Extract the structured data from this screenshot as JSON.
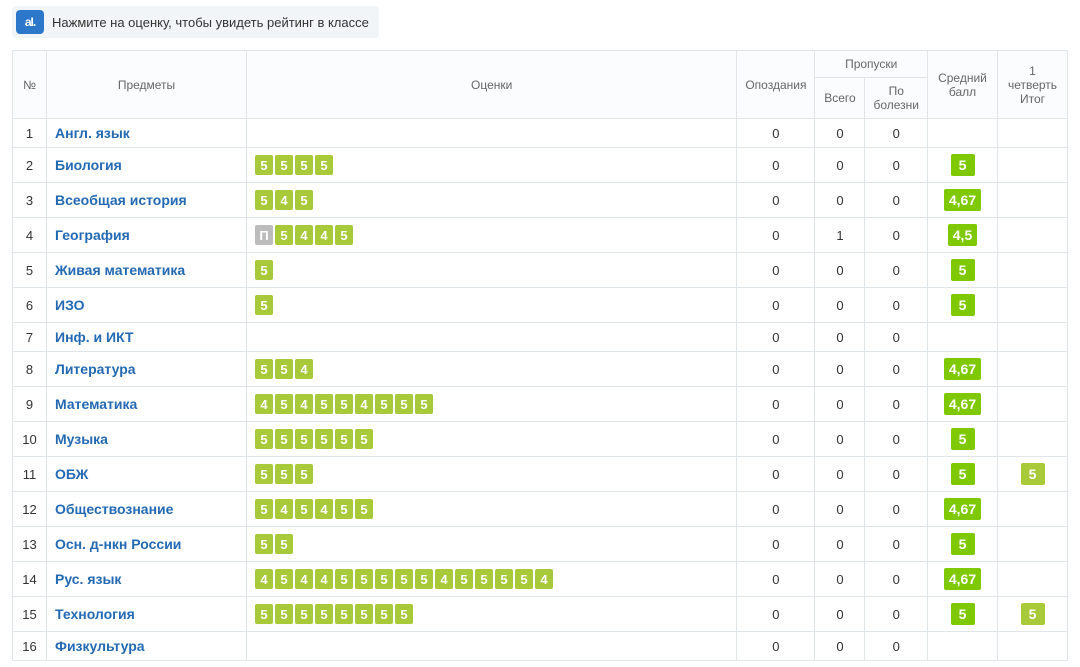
{
  "tip": {
    "icon_label": "aI.",
    "text": "Нажмите на оценку, чтобы увидеть рейтинг в классе"
  },
  "headers": {
    "num": "№",
    "subject": "Предметы",
    "marks": "Оценки",
    "late": "Опоздания",
    "miss_group": "Пропуски",
    "miss_total": "Всего",
    "miss_ill": "По болезни",
    "avg": "Средний балл",
    "term": "1 четверть Итог"
  },
  "rows": [
    {
      "n": "1",
      "subject": "Англ. язык",
      "marks": [],
      "late": "0",
      "miss_total": "0",
      "miss_ill": "0",
      "avg": "",
      "term": ""
    },
    {
      "n": "2",
      "subject": "Биология",
      "marks": [
        "5",
        "5",
        "5",
        "5"
      ],
      "late": "0",
      "miss_total": "0",
      "miss_ill": "0",
      "avg": "5",
      "term": ""
    },
    {
      "n": "3",
      "subject": "Всеобщая история",
      "marks": [
        "5",
        "4",
        "5"
      ],
      "late": "0",
      "miss_total": "0",
      "miss_ill": "0",
      "avg": "4,67",
      "term": ""
    },
    {
      "n": "4",
      "subject": "География",
      "marks": [
        {
          "v": "П",
          "special": true
        },
        "5",
        "4",
        "4",
        "5"
      ],
      "late": "0",
      "miss_total": "1",
      "miss_ill": "0",
      "avg": "4,5",
      "term": ""
    },
    {
      "n": "5",
      "subject": "Живая математика",
      "marks": [
        "5"
      ],
      "late": "0",
      "miss_total": "0",
      "miss_ill": "0",
      "avg": "5",
      "term": ""
    },
    {
      "n": "6",
      "subject": "ИЗО",
      "marks": [
        "5"
      ],
      "late": "0",
      "miss_total": "0",
      "miss_ill": "0",
      "avg": "5",
      "term": ""
    },
    {
      "n": "7",
      "subject": "Инф. и ИКТ",
      "marks": [],
      "late": "0",
      "miss_total": "0",
      "miss_ill": "0",
      "avg": "",
      "term": ""
    },
    {
      "n": "8",
      "subject": "Литература",
      "marks": [
        "5",
        "5",
        "4"
      ],
      "late": "0",
      "miss_total": "0",
      "miss_ill": "0",
      "avg": "4,67",
      "term": ""
    },
    {
      "n": "9",
      "subject": "Математика",
      "marks": [
        "4",
        "5",
        "4",
        "5",
        "5",
        "4",
        "5",
        "5",
        "5"
      ],
      "late": "0",
      "miss_total": "0",
      "miss_ill": "0",
      "avg": "4,67",
      "term": ""
    },
    {
      "n": "10",
      "subject": "Музыка",
      "marks": [
        "5",
        "5",
        "5",
        "5",
        "5",
        "5"
      ],
      "late": "0",
      "miss_total": "0",
      "miss_ill": "0",
      "avg": "5",
      "term": ""
    },
    {
      "n": "11",
      "subject": "ОБЖ",
      "marks": [
        "5",
        "5",
        "5"
      ],
      "late": "0",
      "miss_total": "0",
      "miss_ill": "0",
      "avg": "5",
      "term": "5"
    },
    {
      "n": "12",
      "subject": "Обществознание",
      "marks": [
        "5",
        "4",
        "5",
        "4",
        "5",
        "5"
      ],
      "late": "0",
      "miss_total": "0",
      "miss_ill": "0",
      "avg": "4,67",
      "term": ""
    },
    {
      "n": "13",
      "subject": "Осн. д-нкн России",
      "marks": [
        "5",
        "5"
      ],
      "late": "0",
      "miss_total": "0",
      "miss_ill": "0",
      "avg": "5",
      "term": ""
    },
    {
      "n": "14",
      "subject": "Рус. язык",
      "marks": [
        "4",
        "5",
        "4",
        "4",
        "5",
        "5",
        "5",
        "5",
        "5",
        "4",
        "5",
        "5",
        "5",
        "5",
        "4"
      ],
      "late": "0",
      "miss_total": "0",
      "miss_ill": "0",
      "avg": "4,67",
      "term": ""
    },
    {
      "n": "15",
      "subject": "Технология",
      "marks": [
        "5",
        "5",
        "5",
        "5",
        "5",
        "5",
        "5",
        "5"
      ],
      "late": "0",
      "miss_total": "0",
      "miss_ill": "0",
      "avg": "5",
      "term": "5"
    },
    {
      "n": "16",
      "subject": "Физкультура",
      "marks": [],
      "late": "0",
      "miss_total": "0",
      "miss_ill": "0",
      "avg": "",
      "term": ""
    }
  ]
}
